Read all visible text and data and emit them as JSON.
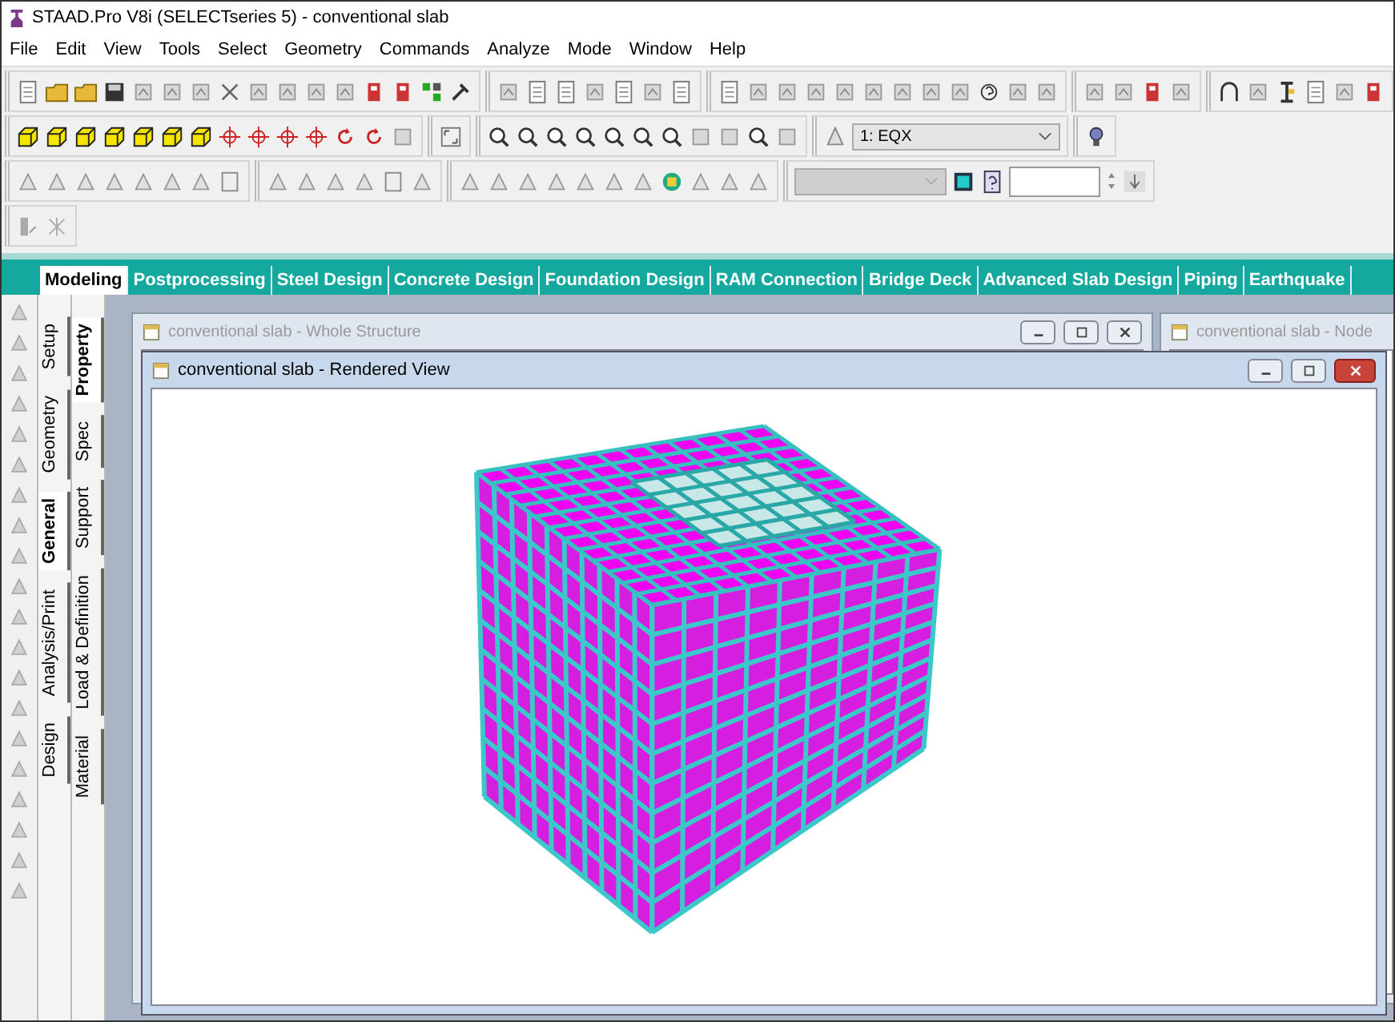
{
  "window": {
    "title": "STAAD.Pro V8i (SELECTseries 5) - conventional slab"
  },
  "menu": [
    "File",
    "Edit",
    "View",
    "Tools",
    "Select",
    "Geometry",
    "Commands",
    "Analyze",
    "Mode",
    "Window",
    "Help"
  ],
  "toolbar": {
    "load_case": "1: EQX"
  },
  "page_tabs": [
    {
      "label": "Modeling",
      "selected": true
    },
    {
      "label": "Postprocessing",
      "selected": false
    },
    {
      "label": "Steel Design",
      "selected": false
    },
    {
      "label": "Concrete Design",
      "selected": false
    },
    {
      "label": "Foundation Design",
      "selected": false
    },
    {
      "label": "RAM Connection",
      "selected": false
    },
    {
      "label": "Bridge Deck",
      "selected": false
    },
    {
      "label": "Advanced Slab Design",
      "selected": false
    },
    {
      "label": "Piping",
      "selected": false
    },
    {
      "label": "Earthquake",
      "selected": false
    }
  ],
  "side_tabs": {
    "groups": [
      {
        "label": "Setup",
        "selected": false
      },
      {
        "label": "Geometry",
        "selected": false
      },
      {
        "label": "General",
        "selected": true
      },
      {
        "label": "Analysis/Print",
        "selected": false
      },
      {
        "label": "Design",
        "selected": false
      }
    ],
    "pages": [
      {
        "label": "Property",
        "selected": true
      },
      {
        "label": "Spec",
        "selected": false
      },
      {
        "label": "Support",
        "selected": false
      },
      {
        "label": "Load & Definition",
        "selected": false
      },
      {
        "label": "Material",
        "selected": false
      }
    ]
  },
  "windows": [
    {
      "title": "conventional slab - Whole Structure",
      "active": false
    },
    {
      "title": "conventional slab - Node",
      "active": false
    },
    {
      "title": "conventional slab - Rendered View",
      "active": true
    }
  ]
}
